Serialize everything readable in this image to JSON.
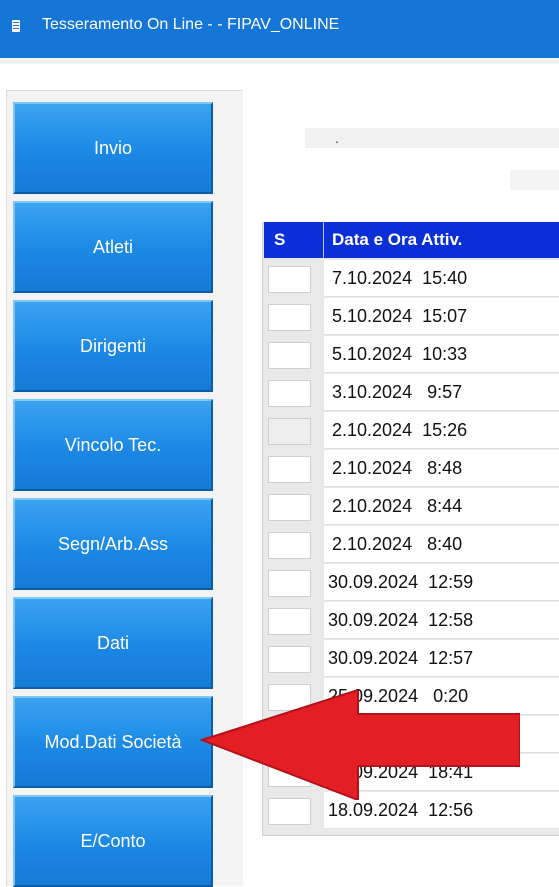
{
  "window": {
    "title": "Tesseramento On Line - - FIPAV_ONLINE",
    "icon": "document-icon",
    "accent": "#1576d8"
  },
  "sidebar": {
    "buttons": [
      {
        "label": "Invio"
      },
      {
        "label": "Atleti"
      },
      {
        "label": "Dirigenti"
      },
      {
        "label": "Vincolo Tec."
      },
      {
        "label": "Segn/Arb.Ass"
      },
      {
        "label": "Dati"
      },
      {
        "label": "Mod.Dati Società"
      },
      {
        "label": "E/Conto"
      }
    ]
  },
  "header_area": {
    "text": "."
  },
  "table": {
    "header_color": "#0b2fd6",
    "columns": [
      "S",
      "Data e Ora Attiv."
    ],
    "rows": [
      {
        "s": "",
        "datetime": "7.10.2024  15:40"
      },
      {
        "s": "",
        "datetime": "5.10.2024  15:07"
      },
      {
        "s": "",
        "datetime": "5.10.2024  10:33"
      },
      {
        "s": "",
        "datetime": "3.10.2024   9:57"
      },
      {
        "s": "",
        "datetime": "2.10.2024  15:26"
      },
      {
        "s": "",
        "datetime": "2.10.2024   8:48"
      },
      {
        "s": "",
        "datetime": "2.10.2024   8:44"
      },
      {
        "s": "",
        "datetime": "2.10.2024   8:40"
      },
      {
        "s": "",
        "datetime": "30.09.2024  12:59"
      },
      {
        "s": "",
        "datetime": "30.09.2024  12:58"
      },
      {
        "s": "",
        "datetime": "30.09.2024  12:57"
      },
      {
        "s": "",
        "datetime": "25.09.2024   0:20"
      },
      {
        "s": "",
        "datetime": ""
      },
      {
        "s": "",
        "datetime": "20.09.2024  18:41"
      },
      {
        "s": "",
        "datetime": "18.09.2024  12:56"
      }
    ]
  },
  "annotation": {
    "color": "#e41e25",
    "icon": "red-arrow-annotation"
  }
}
